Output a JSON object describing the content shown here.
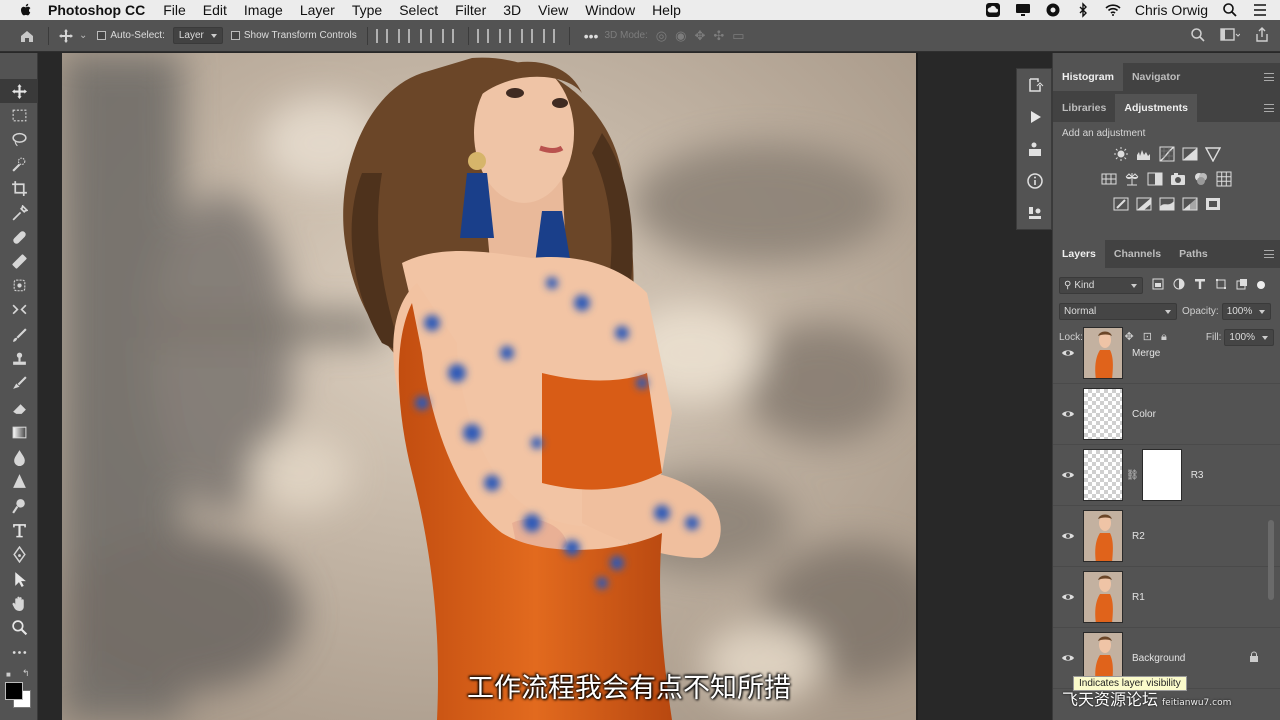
{
  "menubar": {
    "app_name": "Photoshop CC",
    "items": [
      "File",
      "Edit",
      "Image",
      "Layer",
      "Type",
      "Select",
      "Filter",
      "3D",
      "View",
      "Window",
      "Help"
    ],
    "user": "Chris Orwig"
  },
  "options_bar": {
    "auto_select_label": "Auto-Select:",
    "auto_select_value": "Layer",
    "show_transform_label": "Show Transform Controls",
    "mode_label": "3D Mode:"
  },
  "panels": {
    "top_tabs": [
      "Histogram",
      "Navigator"
    ],
    "mid_tabs": [
      "Libraries",
      "Adjustments"
    ],
    "adjustments_title": "Add an adjustment",
    "layers_tabs": [
      "Layers",
      "Channels",
      "Paths"
    ]
  },
  "layers_panel": {
    "filter_kind": "Kind",
    "blend_mode": "Normal",
    "opacity_label": "Opacity:",
    "opacity_value": "100%",
    "lock_label": "Lock:",
    "fill_label": "Fill:",
    "fill_value": "100%",
    "layers": [
      {
        "name": "Merge",
        "thumb": "photo"
      },
      {
        "name": "Color",
        "thumb": "transparent"
      },
      {
        "name": "R3",
        "thumb": "transparent",
        "mask": true
      },
      {
        "name": "R2",
        "thumb": "photo"
      },
      {
        "name": "R1",
        "thumb": "photo"
      },
      {
        "name": "Background",
        "thumb": "photo",
        "locked": true
      }
    ]
  },
  "tooltip": "Indicates layer visibility",
  "subtitle": "工作流程我会有点不知所措",
  "watermark": {
    "text": "飞天资源论坛",
    "url": "feitianwu7.com"
  },
  "colors": {
    "dress": "#e0631b",
    "sleeve": "#f3c7a8",
    "flower": "#2a58b8",
    "earring": "#1a3f8a",
    "wall": "#c9b8a5"
  }
}
